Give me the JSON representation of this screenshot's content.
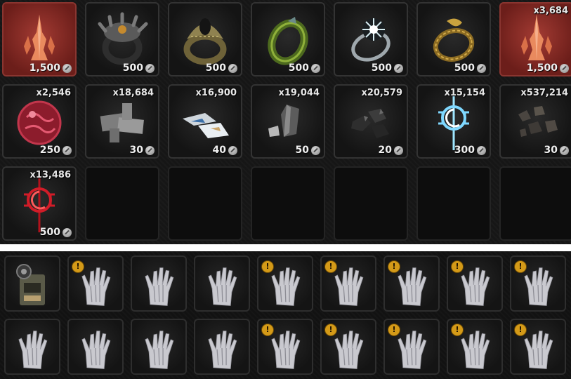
{
  "stash_grid": {
    "row1": [
      {
        "item": "crimson-crystal",
        "qty": "",
        "price": "1,500",
        "highlight": true
      },
      {
        "item": "tentacle-ring",
        "qty": "",
        "price": "500",
        "highlight": false
      },
      {
        "item": "gold-scale-ring",
        "qty": "",
        "price": "500",
        "highlight": false
      },
      {
        "item": "jade-ring",
        "qty": "",
        "price": "500",
        "highlight": false
      },
      {
        "item": "frost-ring",
        "qty": "",
        "price": "500",
        "highlight": false
      },
      {
        "item": "golden-serpent-ring",
        "qty": "",
        "price": "500",
        "highlight": false
      },
      {
        "item": "crimson-crystal",
        "qty": "x3,684",
        "price": "1,500",
        "highlight": true
      }
    ],
    "row2": [
      {
        "item": "blood-orb",
        "qty": "x2,546",
        "price": "250"
      },
      {
        "item": "iron-plates",
        "qty": "x18,684",
        "price": "30"
      },
      {
        "item": "cloth-scraps",
        "qty": "x16,900",
        "price": "40"
      },
      {
        "item": "stone-shards",
        "qty": "x19,044",
        "price": "50"
      },
      {
        "item": "coal-chunks",
        "qty": "x20,579",
        "price": "20"
      },
      {
        "item": "frost-sigil",
        "qty": "x15,154",
        "price": "300"
      },
      {
        "item": "rubble",
        "qty": "x537,214",
        "price": "30"
      }
    ],
    "row3": [
      {
        "item": "blood-sigil",
        "qty": "x13,486",
        "price": "500"
      }
    ]
  },
  "hand_slots": {
    "row1_first": "device-pack",
    "row1_warn": [
      false,
      true,
      false,
      false,
      true,
      true,
      true,
      true,
      true
    ],
    "row2_warn": [
      false,
      false,
      false,
      false,
      true,
      true,
      true,
      true,
      true
    ],
    "warn_symbol": "!"
  },
  "colors": {
    "highlight": "#8a2e28",
    "warning": "#d49a18"
  }
}
